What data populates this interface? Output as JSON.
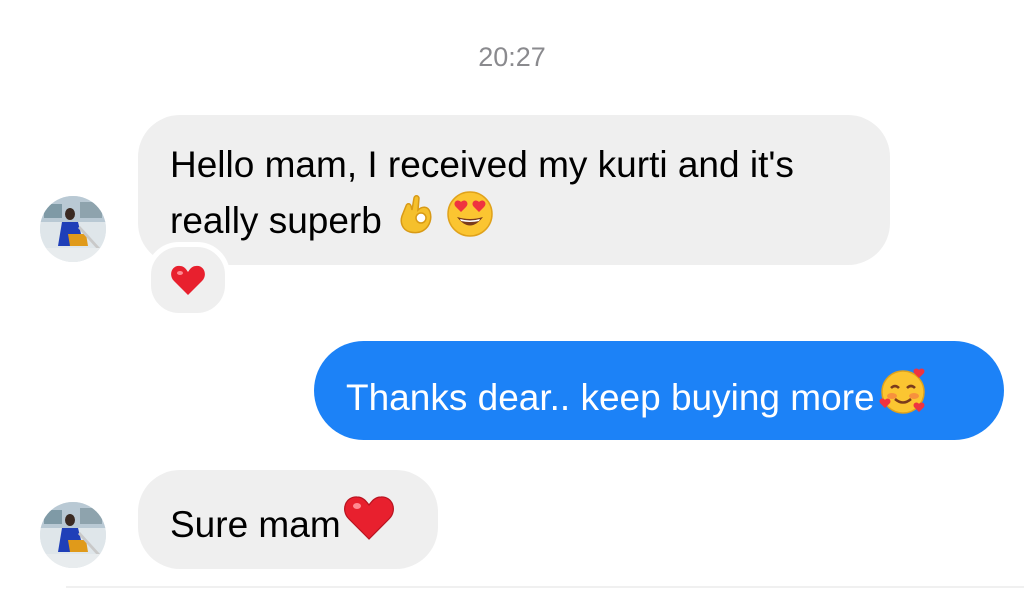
{
  "conversation": {
    "timestamp": "20:27",
    "messages": [
      {
        "direction": "incoming",
        "line1": "Hello mam, I received my kurti and it's",
        "line2": "really superb",
        "emojis": [
          "ok-hand-emoji",
          "heart-eyes-emoji"
        ],
        "reaction": "red-heart-emoji"
      },
      {
        "direction": "outgoing",
        "text": "Thanks dear.. keep buying more",
        "emojis": [
          "smiling-face-with-hearts-emoji"
        ]
      },
      {
        "direction": "incoming",
        "text": "Sure mam",
        "emojis": [
          "red-heart-emoji"
        ]
      }
    ]
  },
  "colors": {
    "incoming_bubble": "#efefef",
    "outgoing_bubble": "#1c82f7",
    "timestamp": "#8a8a8e"
  }
}
